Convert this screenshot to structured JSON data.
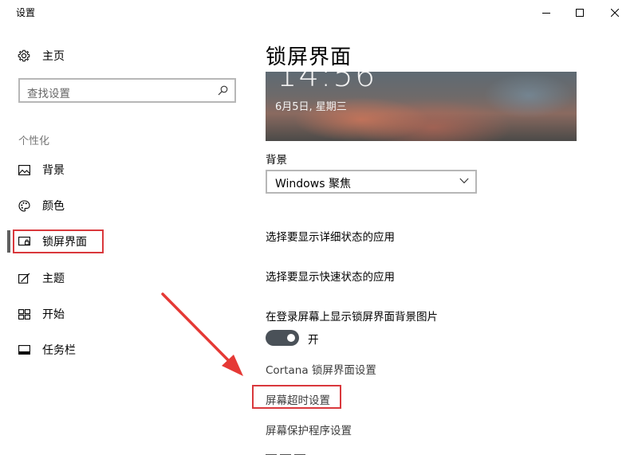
{
  "window": {
    "title": "设置"
  },
  "sidebar": {
    "home_label": "主页",
    "search_placeholder": "查找设置",
    "section": "个性化",
    "items": [
      {
        "label": "背景",
        "icon": "picture-icon"
      },
      {
        "label": "颜色",
        "icon": "palette-icon"
      },
      {
        "label": "锁屏界面",
        "icon": "lockscreen-icon",
        "selected": true
      },
      {
        "label": "主题",
        "icon": "theme-icon"
      },
      {
        "label": "开始",
        "icon": "start-icon"
      },
      {
        "label": "任务栏",
        "icon": "taskbar-icon"
      }
    ]
  },
  "main": {
    "title": "锁屏界面",
    "preview": {
      "time": "14:56",
      "date": "6月5日, 星期三"
    },
    "background_label": "背景",
    "background_value": "Windows 聚焦",
    "detail_status_link": "选择要显示详细状态的应用",
    "quick_status_link": "选择要显示快速状态的应用",
    "show_bg_label": "在登录屏幕上显示锁屏界面背景图片",
    "toggle": {
      "state": "开",
      "on": true
    },
    "cortana_link": "Cortana 锁屏界面设置",
    "timeout_link": "屏幕超时设置",
    "screensaver_link": "屏幕保护程序设置"
  },
  "annotations": {
    "highlight_color": "#d9383c"
  }
}
